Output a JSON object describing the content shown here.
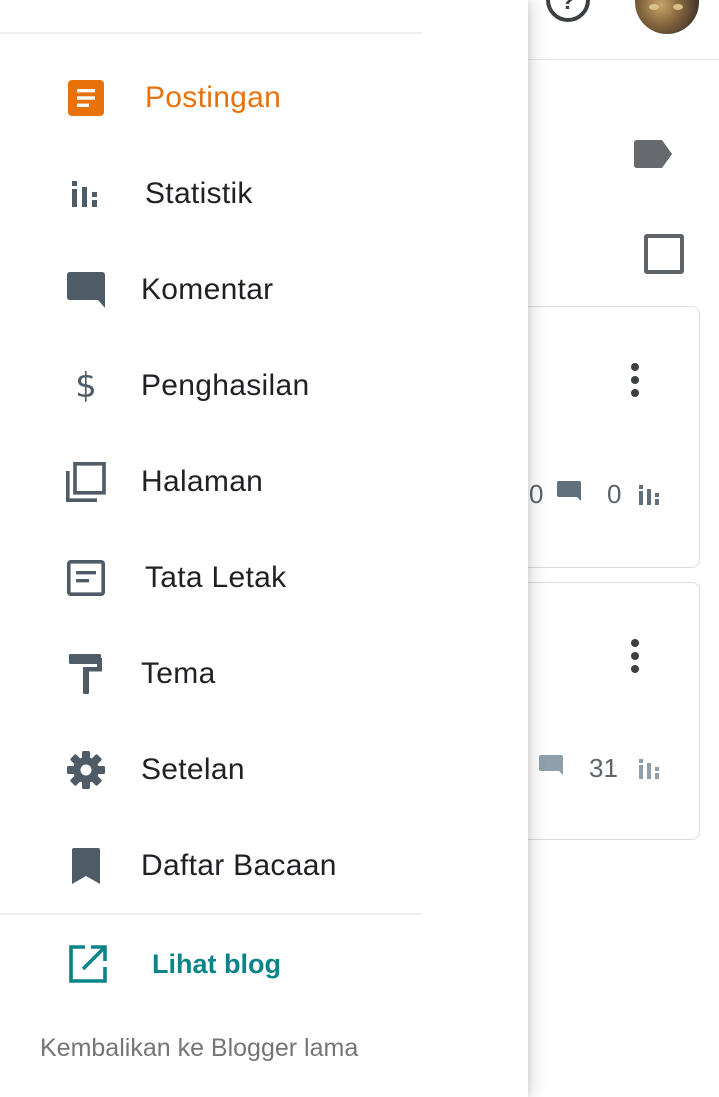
{
  "background": {
    "post_cards": [
      {
        "comment_count": "0",
        "view_count": "0"
      },
      {
        "comment_count": "",
        "view_count": "31"
      }
    ]
  },
  "drawer": {
    "nav_items": [
      {
        "label": "Postingan",
        "icon": "posts-icon",
        "active": true
      },
      {
        "label": "Statistik",
        "icon": "stats-icon",
        "active": false
      },
      {
        "label": "Komentar",
        "icon": "comment-icon",
        "active": false
      },
      {
        "label": "Penghasilan",
        "icon": "dollar-icon",
        "active": false
      },
      {
        "label": "Halaman",
        "icon": "pages-icon",
        "active": false
      },
      {
        "label": "Tata Letak",
        "icon": "layout-icon",
        "active": false
      },
      {
        "label": "Tema",
        "icon": "paint-roller-icon",
        "active": false
      },
      {
        "label": "Setelan",
        "icon": "gear-icon",
        "active": false
      },
      {
        "label": "Daftar Bacaan",
        "icon": "bookmark-icon",
        "active": false
      }
    ],
    "view_blog": {
      "label": "Lihat blog",
      "icon": "open-in-new-icon"
    },
    "legacy_link": "Kembalikan ke Blogger lama"
  },
  "colors": {
    "active": "#e8710a",
    "icon": "#4f5b66",
    "link": "#0b8489",
    "text": "#202124",
    "muted": "#757575"
  }
}
